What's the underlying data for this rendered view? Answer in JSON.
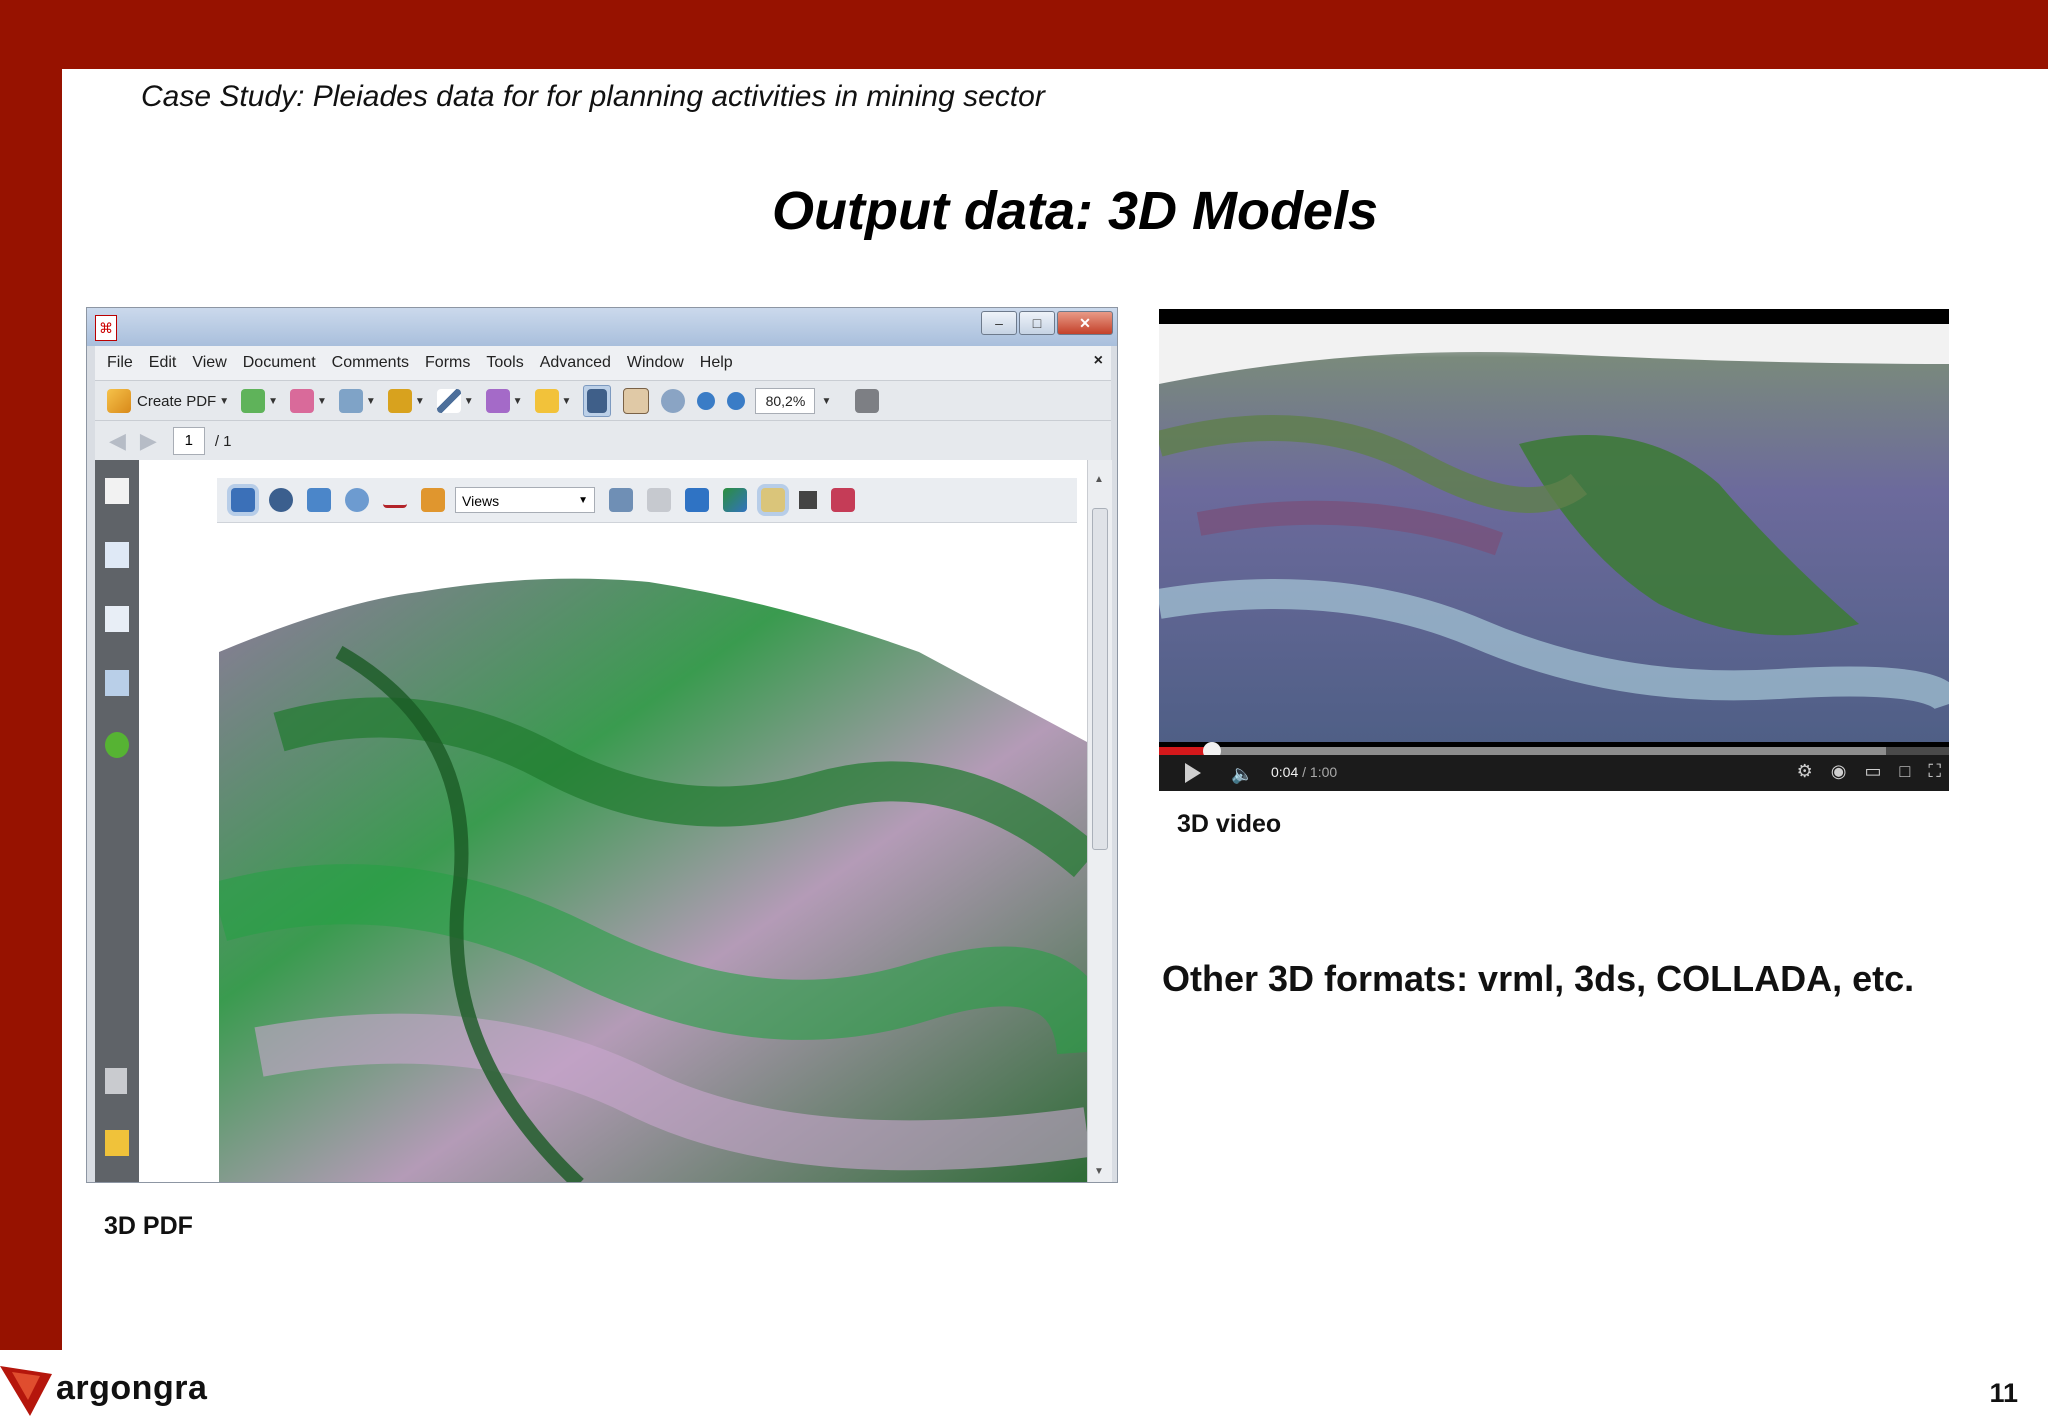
{
  "slide": {
    "subtitle": "Case Study: Pleiades data for for planning activities in mining sector",
    "title": "Output data: 3D Models",
    "page_number": "11",
    "brand_color": "#971200",
    "logo_text": "argongra"
  },
  "pdf_viewer": {
    "menu": [
      "File",
      "Edit",
      "View",
      "Document",
      "Comments",
      "Forms",
      "Tools",
      "Advanced",
      "Window",
      "Help"
    ],
    "menu_close": "×",
    "create_pdf_label": "Create PDF",
    "zoom": "80,2%",
    "page_current": "1",
    "page_total": "/ 1",
    "views_label": "Views",
    "caption": "3D PDF",
    "window_buttons": [
      "–",
      "□",
      "✕"
    ]
  },
  "video_player": {
    "time_current": "0:04",
    "time_total": "/ 1:00",
    "progress_fraction": 0.067,
    "buffered_fraction": 0.92,
    "caption": "3D video"
  },
  "other_formats": "Other 3D formats: vrml, 3ds, COLLADA, etc.",
  "icons": {
    "play": "play-icon",
    "volume": "volume-icon",
    "settings": "gear-icon",
    "fullscreen": "fullscreen-icon"
  }
}
